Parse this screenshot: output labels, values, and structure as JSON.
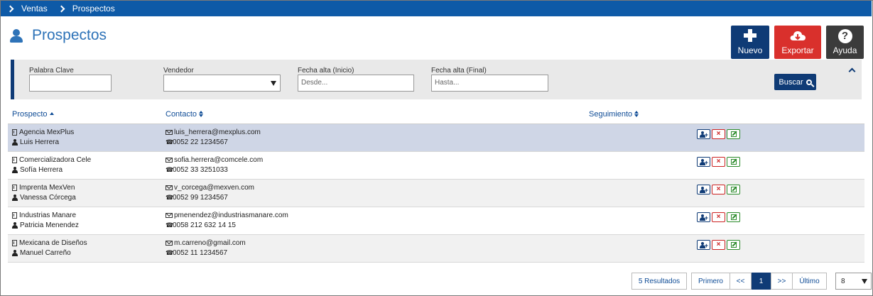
{
  "breadcrumb": {
    "items": [
      "Ventas",
      "Prospectos"
    ]
  },
  "page": {
    "title": "Prospectos"
  },
  "actions": {
    "nuevo": "Nuevo",
    "exportar": "Exportar",
    "ayuda": "Ayuda"
  },
  "filters": {
    "keyword_label": "Palabra Clave",
    "keyword_value": "",
    "seller_label": "Vendedor",
    "seller_value": "",
    "date_start_label": "Fecha alta (Inicio)",
    "date_start_placeholder": "Desde...",
    "date_end_label": "Fecha alta (Final)",
    "date_end_placeholder": "Hasta...",
    "search_label": "Buscar"
  },
  "table": {
    "headers": {
      "prospecto": "Prospecto",
      "contacto": "Contacto",
      "seguimiento": "Seguimiento"
    },
    "rows": [
      {
        "company": "Agencia MexPlus",
        "person": "Luis Herrera",
        "email": "luis_herrera@mexplus.com",
        "phone": "0052 22 1234567",
        "seguimiento": "",
        "selected": true
      },
      {
        "company": "Comercializadora Cele",
        "person": "Sofía Herrera",
        "email": "sofia.herrera@comcele.com",
        "phone": "0052 33 3251033",
        "seguimiento": ""
      },
      {
        "company": "Imprenta MexVen",
        "person": "Vanessa Córcega",
        "email": "v_corcega@mexven.com",
        "phone": "0052 99 1234567",
        "seguimiento": ""
      },
      {
        "company": "Industrias Manare",
        "person": "Patricia Menendez",
        "email": "pmenendez@industriasmanare.com",
        "phone": "0058 212 632 14 15",
        "seguimiento": ""
      },
      {
        "company": "Mexicana de Diseños",
        "person": "Manuel Carreño",
        "email": "m.carreno@gmail.com",
        "phone": "0052 11 1234567",
        "seguimiento": ""
      }
    ]
  },
  "pagination": {
    "results": "5 Resultados",
    "first": "Primero",
    "prev": "<<",
    "current": "1",
    "next": ">>",
    "last": "Último",
    "per_page": "8"
  },
  "colors": {
    "brand": "#0e5aa7",
    "dark_blue": "#0f3b76",
    "export_red": "#d9302c",
    "help_dark": "#3b3b3b",
    "selected_row": "#cfd6e6"
  }
}
